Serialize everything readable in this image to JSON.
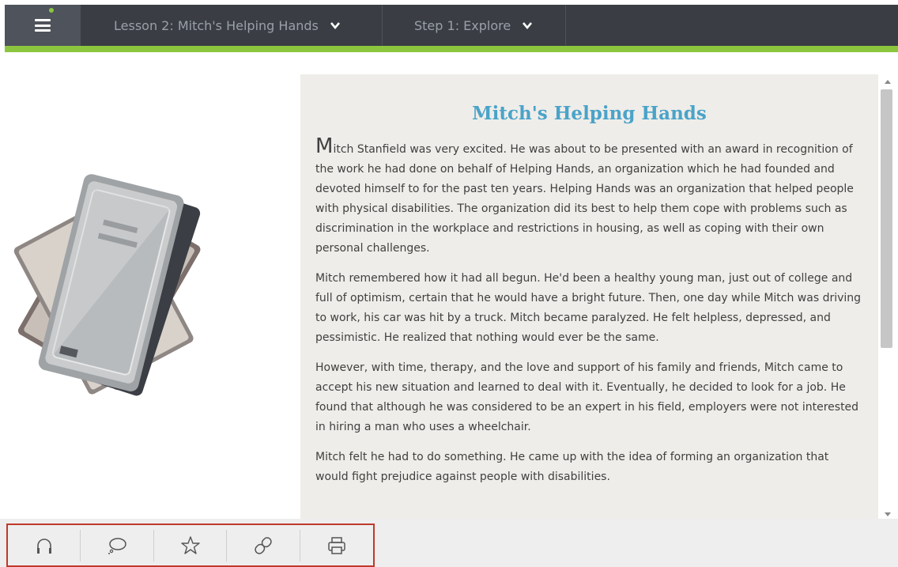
{
  "nav": {
    "lesson_label": "Lesson 2: Mitch's Helping Hands",
    "step_label": "Step 1: Explore"
  },
  "article": {
    "title": "Mitch's Helping Hands",
    "first_letter": "M",
    "paragraphs": [
      "itch Stanfield was very excited. He was about to be presented with an award in recognition of the work he had done on behalf of Helping Hands, an organization which he had founded and devoted himself to for the past ten years. Helping Hands was an organization that helped people with physical disabilities. The organization did its best to help them cope with problems such as discrimination in the workplace and restrictions in housing, as well as coping with their own personal challenges.",
      "Mitch remembered how it had all begun. He'd been a healthy young man, just out of college and full of optimism, certain that he would have a bright future. Then, one day while Mitch was driving to work, his car was hit by a truck. Mitch became paralyzed. He felt helpless, depressed, and pessimistic. He realized that nothing would ever be the same.",
      "However, with time, therapy, and the love and support of his family and friends, Mitch came to accept his new situation and learned to deal with it. Eventually, he decided to look for a job. He found that although he was considered to be an expert in his field, employers were not interested in hiring a man who uses a wheelchair.",
      "Mitch felt he had to do something. He came up with the idea of forming an organization that would fight prejudice against people with disabilities."
    ]
  },
  "toolbar": {
    "tools": [
      "headphones-icon",
      "speech-bubble-icon",
      "star-icon",
      "link-icon",
      "print-icon"
    ]
  },
  "colors": {
    "nav_bg": "#3a3d44",
    "accent_green": "#8cc63f",
    "title_blue": "#4aa3c9",
    "panel_bg": "#efede9",
    "highlight_red": "#c0392b"
  }
}
